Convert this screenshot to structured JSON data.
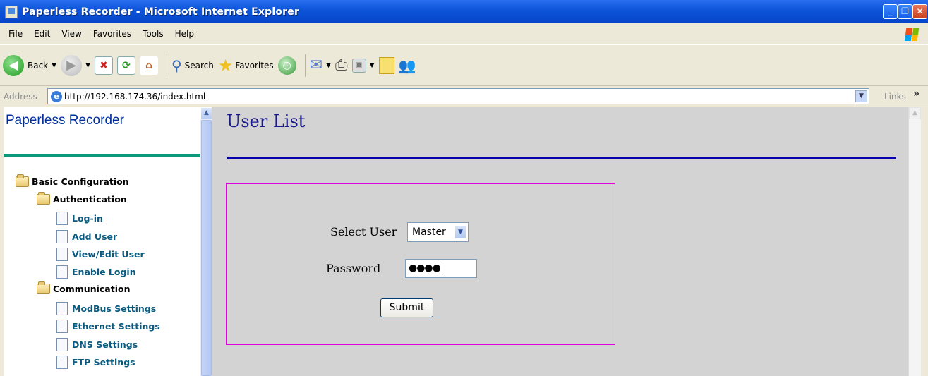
{
  "window": {
    "title": "Paperless Recorder - Microsoft Internet Explorer"
  },
  "menu": [
    "File",
    "Edit",
    "View",
    "Favorites",
    "Tools",
    "Help"
  ],
  "toolbar": {
    "back": "Back",
    "search": "Search",
    "favorites": "Favorites"
  },
  "address": {
    "label": "Address",
    "url": "http://192.168.174.36/index.html",
    "links": "Links",
    "links_chevron": "»"
  },
  "nav": {
    "brand": "Paperless Recorder",
    "items": [
      {
        "label": "Basic Configuration",
        "type": "folder",
        "level": 0
      },
      {
        "label": "Authentication",
        "type": "folder",
        "level": 1
      },
      {
        "label": "Log-in",
        "type": "page",
        "level": 2
      },
      {
        "label": "Add User",
        "type": "page",
        "level": 2
      },
      {
        "label": "View/Edit User",
        "type": "page",
        "level": 2
      },
      {
        "label": "Enable Login",
        "type": "page",
        "level": 2
      },
      {
        "label": "Communication",
        "type": "folder",
        "level": 1
      },
      {
        "label": "ModBus Settings",
        "type": "page",
        "level": 2
      },
      {
        "label": "Ethernet Settings",
        "type": "page",
        "level": 2
      },
      {
        "label": "DNS Settings",
        "type": "page",
        "level": 2
      },
      {
        "label": "FTP Settings",
        "type": "page",
        "level": 2
      }
    ]
  },
  "main": {
    "title": "User List",
    "form": {
      "select_label": "Select User",
      "selected_user": "Master",
      "password_label": "Password",
      "password_mask": "●●●●",
      "submit_label": "Submit"
    }
  },
  "colors": {
    "title_blue": "#1a1a8c",
    "rule_blue": "#0000b0",
    "box_border": "#e000e0",
    "brand_teal": "#0a9a7a",
    "main_bg": "#d3d3d3"
  }
}
